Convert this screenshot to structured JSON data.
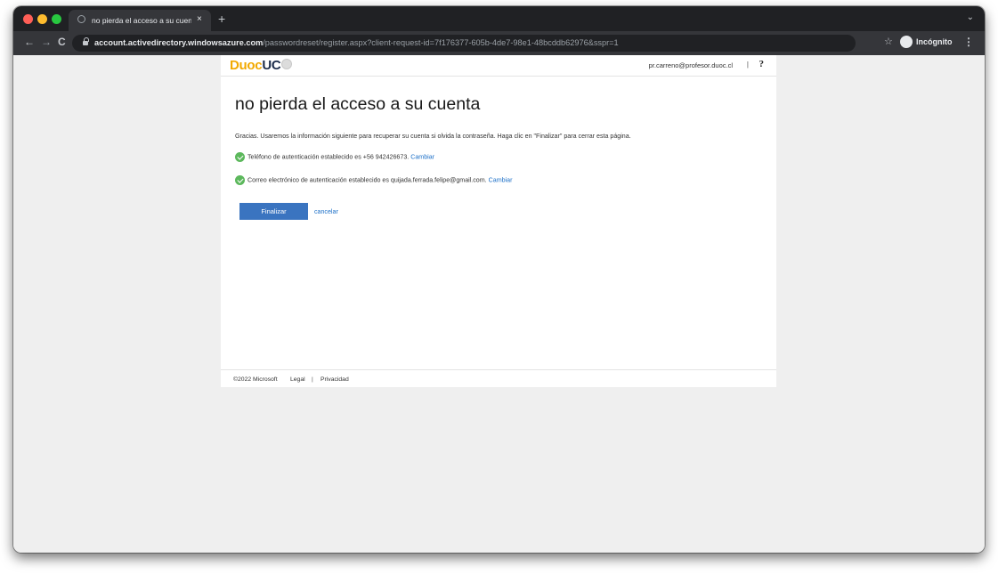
{
  "browser": {
    "tab_title": "no pierda el acceso a su cuenta",
    "tab_close": "×",
    "new_tab": "+",
    "tab_menu": "⌄",
    "url_host": "account.activedirectory.windowsazure.com",
    "url_path": "/passwordreset/register.aspx?client-request-id=7f176377-605b-4de7-98e1-48bcddb62976&sspr=1",
    "incognito_label": "Incógnito"
  },
  "header": {
    "logo_duoc": "Duoc",
    "logo_uc": "UC",
    "user_email": "pr.carreno@profesor.duoc.cl",
    "separator": "|",
    "help": "?"
  },
  "main": {
    "title": "no pierda el acceso a su cuenta",
    "intro": "Gracias. Usaremos la información siguiente para recuperar su cuenta si olvida la contraseña. Haga clic en \"Finalizar\" para cerrar esta página.",
    "phone_text": "Teléfono de autenticación establecido es +56 942426673.",
    "phone_change": "Cambiar",
    "email_text": "Correo electrónico de autenticación establecido es quijada.ferrada.felipe@gmail.com.",
    "email_change": "Cambiar",
    "finish_button": "Finalizar",
    "cancel_link": "cancelar"
  },
  "footer": {
    "copyright": "©2022 Microsoft",
    "legal": "Legal",
    "separator": "|",
    "privacy": "Privacidad"
  },
  "colors": {
    "primary_button": "#3a74c0",
    "link": "#1a6ec7",
    "success": "#5cb85c",
    "brand_yellow": "#f2a900",
    "brand_navy": "#1b2c4a"
  }
}
